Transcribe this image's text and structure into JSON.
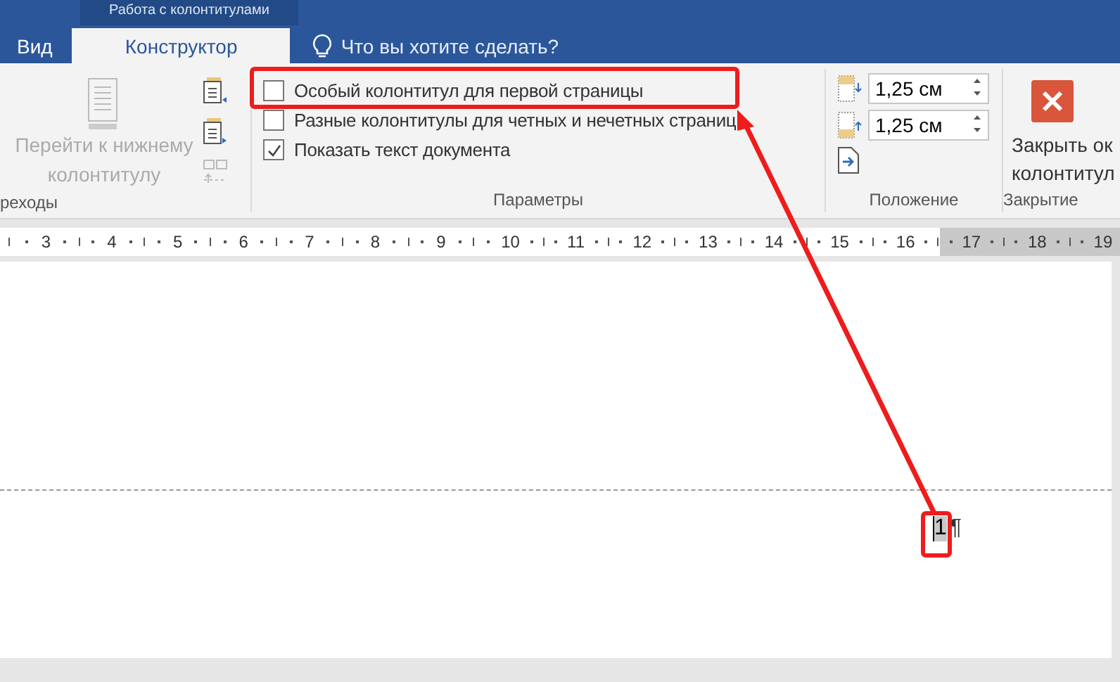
{
  "window": {
    "contextual_title": "Работа с колонтитулами"
  },
  "tabs": [
    {
      "label": "Вид",
      "selected": false
    },
    {
      "label": "Конструктор",
      "selected": true
    }
  ],
  "tell_me": {
    "placeholder": "Что вы хотите сделать?"
  },
  "navigation": {
    "label": "реходы",
    "button": {
      "label": "Перейти к нижнему колонтитулу",
      "disabled": true
    }
  },
  "options": {
    "label": "Параметры",
    "checkboxes": [
      {
        "label": "Особый колонтитул для первой страницы",
        "checked": false
      },
      {
        "label": "Разные колонтитулы для четных и нечетных страниц",
        "checked": false
      },
      {
        "label": "Показать текст документа",
        "checked": true
      }
    ]
  },
  "position": {
    "label": "Положение",
    "spinners": [
      {
        "value": "1,25 см"
      },
      {
        "value": "1,25 см"
      }
    ]
  },
  "close": {
    "label": "Закрытие",
    "button": [
      "Закрыть ок",
      "колонтитул"
    ]
  },
  "ruler": {
    "labels": [
      "3",
      "4",
      "5",
      "6",
      "7",
      "8",
      "9",
      "10",
      "11",
      "12",
      "13",
      "14",
      "15",
      "16",
      "17",
      "18",
      "19"
    ]
  },
  "document": {
    "page_number": "1",
    "paragraph_mark": "¶"
  }
}
